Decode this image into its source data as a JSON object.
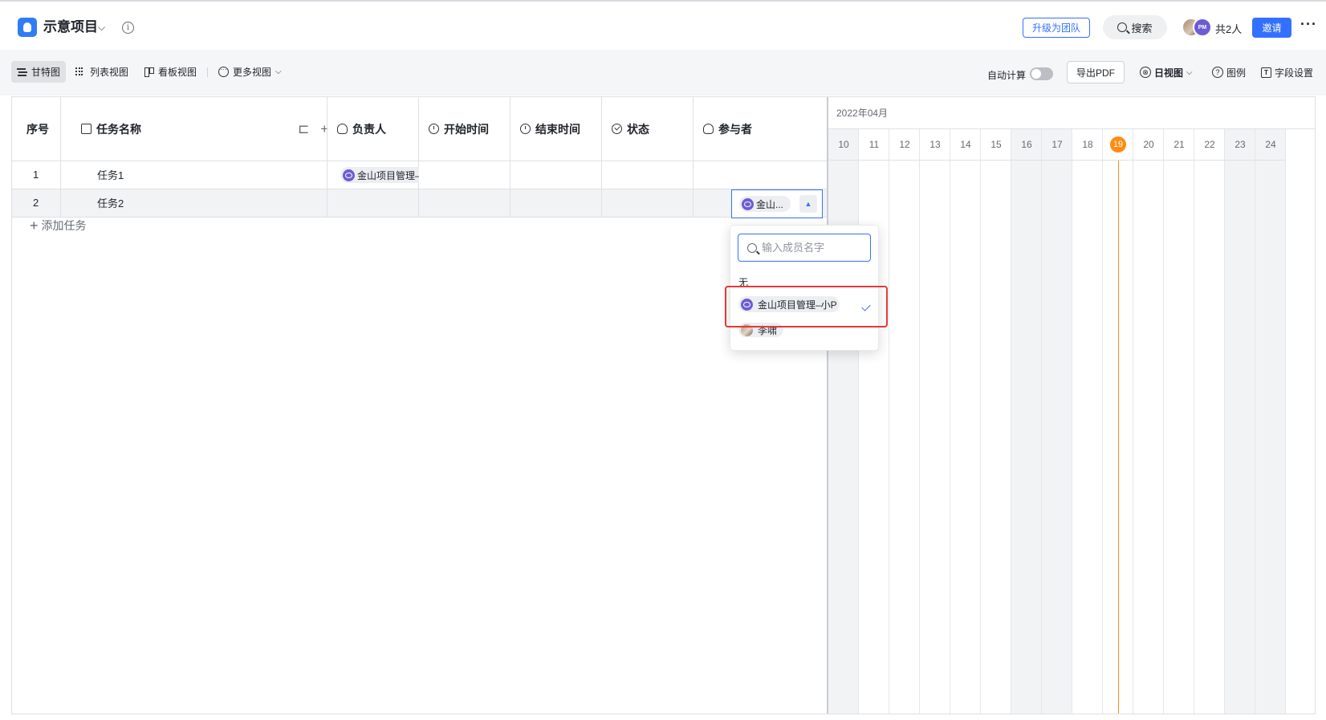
{
  "header": {
    "project_title": "示意项目",
    "upgrade_label": "升级为团队",
    "search_label": "搜索",
    "avatar_pm_text": "PM",
    "member_count": "共2人",
    "invite_label": "邀请",
    "more_icon": "more-icon"
  },
  "toolbar": {
    "views": [
      "甘特图",
      "列表视图",
      "看板视图",
      "更多视图"
    ],
    "active_view": "甘特图",
    "auto_calc_label": "自动计算",
    "auto_calc_on": false,
    "export_pdf_label": "导出PDF",
    "day_view_label": "日视图",
    "legend_label": "图例",
    "field_settings_label": "字段设置"
  },
  "table": {
    "columns": [
      "序号",
      "任务名称",
      "负责人",
      "开始时间",
      "结束时间",
      "状态",
      "参与者"
    ],
    "rows": [
      {
        "index": "1",
        "name": "任务1",
        "owner": "金山项目管理–小",
        "participant": ""
      },
      {
        "index": "2",
        "name": "任务2",
        "owner": "",
        "participant": "金山..."
      }
    ],
    "add_task_label": "添加任务"
  },
  "gantt": {
    "month": "2022年04月",
    "days": [
      "10",
      "11",
      "12",
      "13",
      "14",
      "15",
      "16",
      "17",
      "18",
      "19",
      "20",
      "21",
      "22",
      "23",
      "24"
    ],
    "weekend_days": [
      "10",
      "16",
      "17",
      "23",
      "24"
    ],
    "today": "19"
  },
  "dropdown": {
    "search_placeholder": "输入成员名字",
    "none_label": "无",
    "members": [
      {
        "name": "金山项目管理–小P",
        "selected": true
      },
      {
        "name": "李啸",
        "selected": false
      }
    ]
  },
  "colors": {
    "accent": "#3370ff",
    "today": "#ff8c12",
    "highlight_box": "#e53935"
  }
}
